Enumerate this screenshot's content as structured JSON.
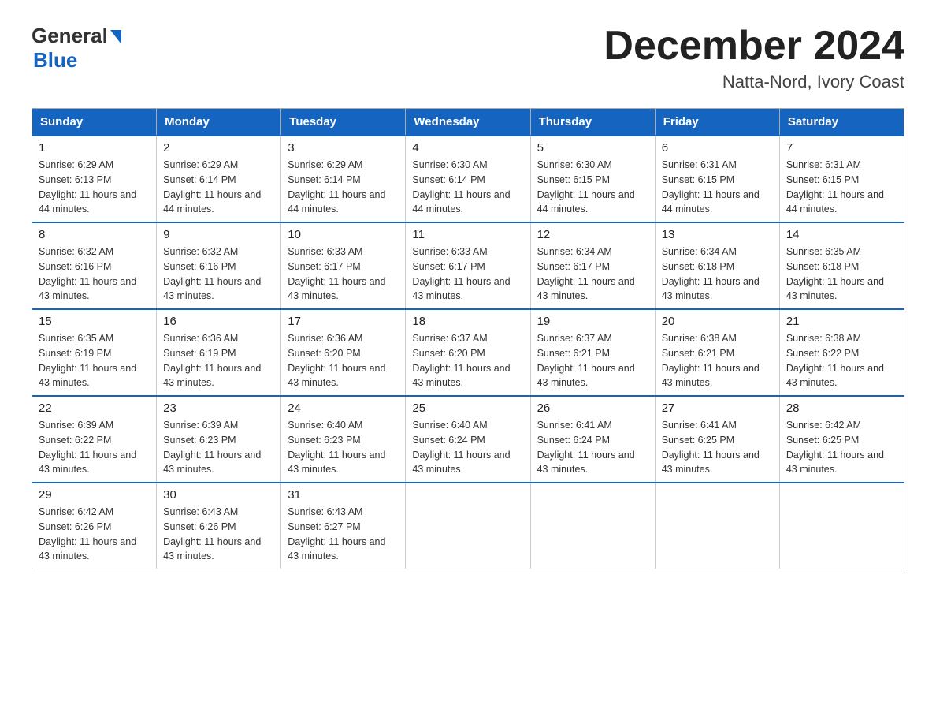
{
  "header": {
    "logo_general": "General",
    "logo_blue": "Blue",
    "month_title": "December 2024",
    "location": "Natta-Nord, Ivory Coast"
  },
  "calendar": {
    "days_of_week": [
      "Sunday",
      "Monday",
      "Tuesday",
      "Wednesday",
      "Thursday",
      "Friday",
      "Saturday"
    ],
    "weeks": [
      [
        {
          "day": "1",
          "sunrise": "6:29 AM",
          "sunset": "6:13 PM",
          "daylight": "11 hours and 44 minutes."
        },
        {
          "day": "2",
          "sunrise": "6:29 AM",
          "sunset": "6:14 PM",
          "daylight": "11 hours and 44 minutes."
        },
        {
          "day": "3",
          "sunrise": "6:29 AM",
          "sunset": "6:14 PM",
          "daylight": "11 hours and 44 minutes."
        },
        {
          "day": "4",
          "sunrise": "6:30 AM",
          "sunset": "6:14 PM",
          "daylight": "11 hours and 44 minutes."
        },
        {
          "day": "5",
          "sunrise": "6:30 AM",
          "sunset": "6:15 PM",
          "daylight": "11 hours and 44 minutes."
        },
        {
          "day": "6",
          "sunrise": "6:31 AM",
          "sunset": "6:15 PM",
          "daylight": "11 hours and 44 minutes."
        },
        {
          "day": "7",
          "sunrise": "6:31 AM",
          "sunset": "6:15 PM",
          "daylight": "11 hours and 44 minutes."
        }
      ],
      [
        {
          "day": "8",
          "sunrise": "6:32 AM",
          "sunset": "6:16 PM",
          "daylight": "11 hours and 43 minutes."
        },
        {
          "day": "9",
          "sunrise": "6:32 AM",
          "sunset": "6:16 PM",
          "daylight": "11 hours and 43 minutes."
        },
        {
          "day": "10",
          "sunrise": "6:33 AM",
          "sunset": "6:17 PM",
          "daylight": "11 hours and 43 minutes."
        },
        {
          "day": "11",
          "sunrise": "6:33 AM",
          "sunset": "6:17 PM",
          "daylight": "11 hours and 43 minutes."
        },
        {
          "day": "12",
          "sunrise": "6:34 AM",
          "sunset": "6:17 PM",
          "daylight": "11 hours and 43 minutes."
        },
        {
          "day": "13",
          "sunrise": "6:34 AM",
          "sunset": "6:18 PM",
          "daylight": "11 hours and 43 minutes."
        },
        {
          "day": "14",
          "sunrise": "6:35 AM",
          "sunset": "6:18 PM",
          "daylight": "11 hours and 43 minutes."
        }
      ],
      [
        {
          "day": "15",
          "sunrise": "6:35 AM",
          "sunset": "6:19 PM",
          "daylight": "11 hours and 43 minutes."
        },
        {
          "day": "16",
          "sunrise": "6:36 AM",
          "sunset": "6:19 PM",
          "daylight": "11 hours and 43 minutes."
        },
        {
          "day": "17",
          "sunrise": "6:36 AM",
          "sunset": "6:20 PM",
          "daylight": "11 hours and 43 minutes."
        },
        {
          "day": "18",
          "sunrise": "6:37 AM",
          "sunset": "6:20 PM",
          "daylight": "11 hours and 43 minutes."
        },
        {
          "day": "19",
          "sunrise": "6:37 AM",
          "sunset": "6:21 PM",
          "daylight": "11 hours and 43 minutes."
        },
        {
          "day": "20",
          "sunrise": "6:38 AM",
          "sunset": "6:21 PM",
          "daylight": "11 hours and 43 minutes."
        },
        {
          "day": "21",
          "sunrise": "6:38 AM",
          "sunset": "6:22 PM",
          "daylight": "11 hours and 43 minutes."
        }
      ],
      [
        {
          "day": "22",
          "sunrise": "6:39 AM",
          "sunset": "6:22 PM",
          "daylight": "11 hours and 43 minutes."
        },
        {
          "day": "23",
          "sunrise": "6:39 AM",
          "sunset": "6:23 PM",
          "daylight": "11 hours and 43 minutes."
        },
        {
          "day": "24",
          "sunrise": "6:40 AM",
          "sunset": "6:23 PM",
          "daylight": "11 hours and 43 minutes."
        },
        {
          "day": "25",
          "sunrise": "6:40 AM",
          "sunset": "6:24 PM",
          "daylight": "11 hours and 43 minutes."
        },
        {
          "day": "26",
          "sunrise": "6:41 AM",
          "sunset": "6:24 PM",
          "daylight": "11 hours and 43 minutes."
        },
        {
          "day": "27",
          "sunrise": "6:41 AM",
          "sunset": "6:25 PM",
          "daylight": "11 hours and 43 minutes."
        },
        {
          "day": "28",
          "sunrise": "6:42 AM",
          "sunset": "6:25 PM",
          "daylight": "11 hours and 43 minutes."
        }
      ],
      [
        {
          "day": "29",
          "sunrise": "6:42 AM",
          "sunset": "6:26 PM",
          "daylight": "11 hours and 43 minutes."
        },
        {
          "day": "30",
          "sunrise": "6:43 AM",
          "sunset": "6:26 PM",
          "daylight": "11 hours and 43 minutes."
        },
        {
          "day": "31",
          "sunrise": "6:43 AM",
          "sunset": "6:27 PM",
          "daylight": "11 hours and 43 minutes."
        },
        null,
        null,
        null,
        null
      ]
    ]
  }
}
